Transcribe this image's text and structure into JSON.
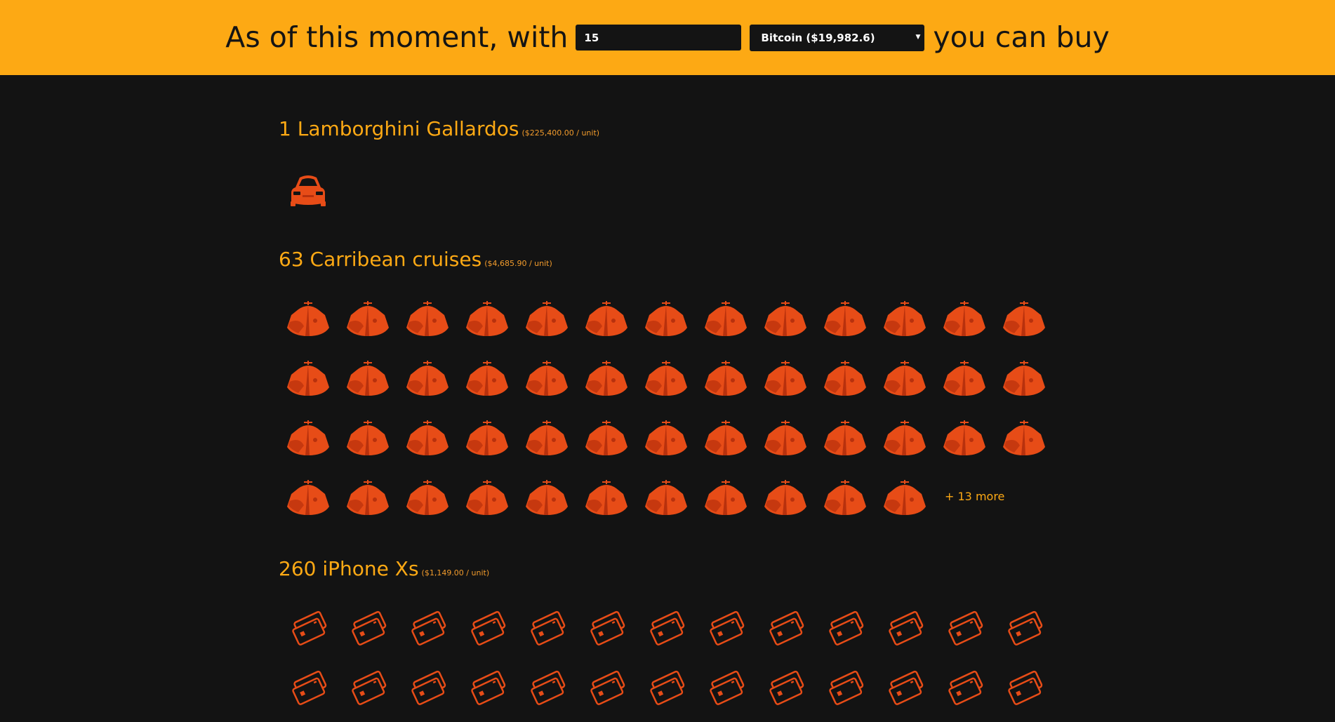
{
  "header": {
    "lead_text": "As of this moment, with",
    "amount_value": "15",
    "currency_selected": "Bitcoin ($19,982.6)",
    "tail_text": "you can buy"
  },
  "sections": [
    {
      "title": "1 Lamborghini Gallardos",
      "price": "($225,400.00 / unit)",
      "icon": "car-icon",
      "shown": 1,
      "more": ""
    },
    {
      "title": "63 Carribean cruises",
      "price": "($4,685.90 / unit)",
      "icon": "cruise-ship-icon",
      "shown": 50,
      "more": "+ 13 more"
    },
    {
      "title": "260 iPhone Xs",
      "price": "($1,149.00 / unit)",
      "icon": "phone-icon",
      "shown": 26,
      "more": ""
    }
  ],
  "colors": {
    "header_bg": "#fda914",
    "page_bg": "#131313",
    "title_text": "#fda914",
    "icon_fill": "#e74c17",
    "icon_shade": "#b8310d"
  }
}
